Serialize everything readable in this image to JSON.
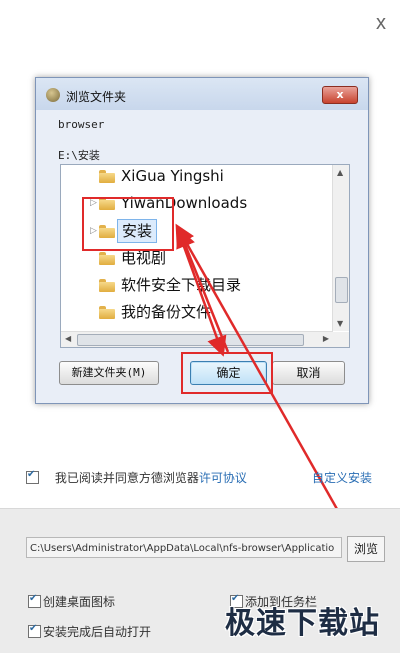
{
  "installer": {
    "close_label": "x",
    "agree_text": "我已阅读并同意方德浏览器",
    "license_link": "许可协议",
    "custom_install": "自定义安装",
    "install_path": "C:\\Users\\Administrator\\AppData\\Local\\nfs-browser\\Applicatio",
    "browse_button": "浏览",
    "options": [
      {
        "label": "创建桌面图标",
        "checked": true
      },
      {
        "label": "添加到任务栏",
        "checked": true
      },
      {
        "label": "安装完成后自动打开",
        "checked": true
      }
    ],
    "watermark": "极速下载站"
  },
  "dialog": {
    "title": "浏览文件夹",
    "close_label": "x",
    "description": "browser",
    "current_path": "E:\\安装",
    "tree_items": [
      {
        "label": "XiGua Yingshi",
        "expander": "",
        "selected": false
      },
      {
        "label": "YiwanDownloads",
        "expander": "▷",
        "selected": false
      },
      {
        "label": "安装",
        "expander": "▷",
        "selected": true
      },
      {
        "label": "电视剧",
        "expander": "",
        "selected": false
      },
      {
        "label": "软件安全下载目录",
        "expander": "",
        "selected": false
      },
      {
        "label": "我的备份文件",
        "expander": "",
        "selected": false
      }
    ],
    "new_folder_button": "新建文件夹(M)",
    "ok_button": "确定",
    "cancel_button": "取消"
  },
  "colors": {
    "highlight": "#e02a2a",
    "link": "#2a6eb4"
  }
}
